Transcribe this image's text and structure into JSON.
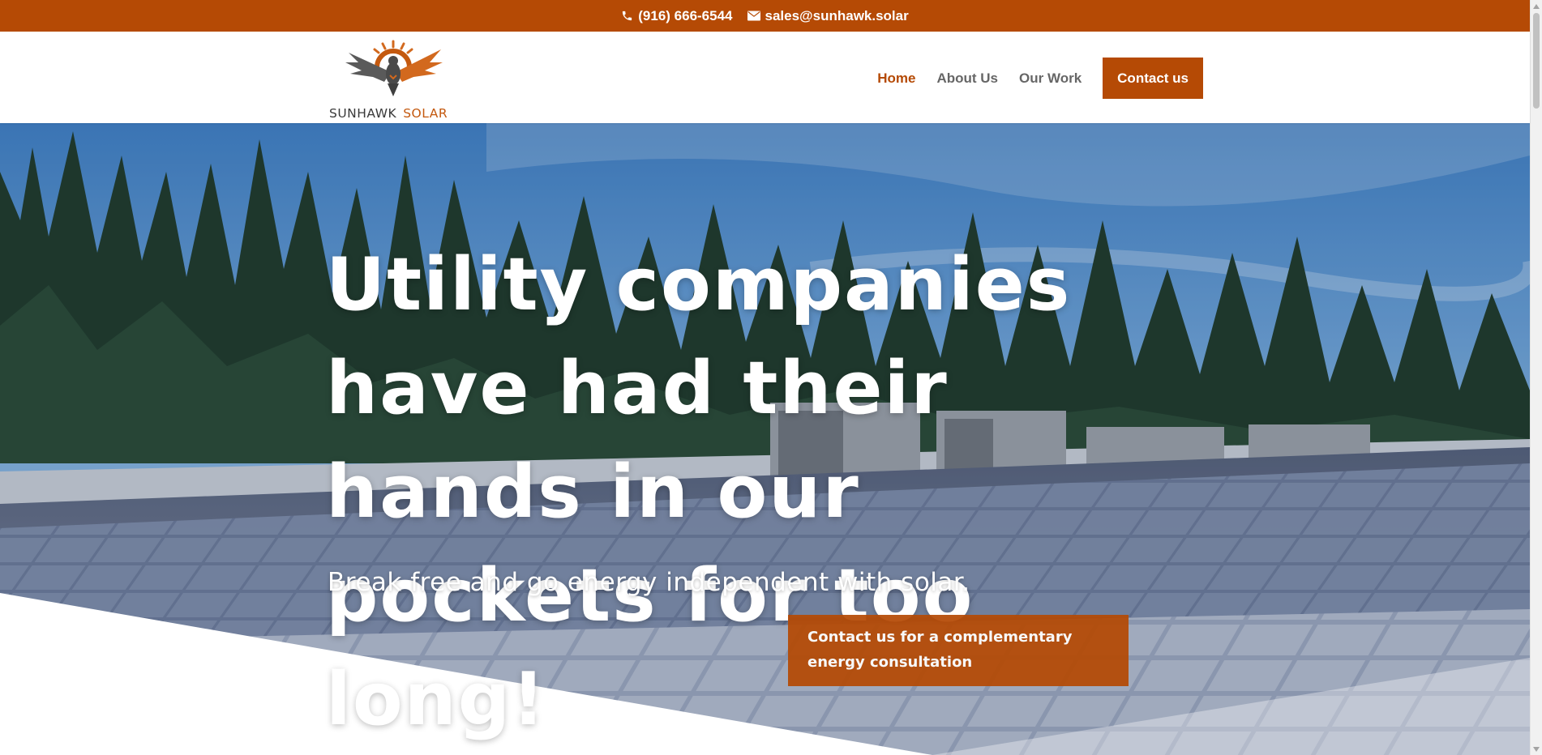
{
  "topbar": {
    "phone": "(916) 666-6544",
    "email": "sales@sunhawk.solar",
    "phone_icon": "phone-icon",
    "email_icon": "envelope-icon"
  },
  "logo": {
    "word1": "SUNHAWK",
    "word2": "SOLAR"
  },
  "nav": {
    "items": [
      {
        "label": "Home",
        "active": true
      },
      {
        "label": "About Us",
        "active": false
      },
      {
        "label": "Our Work",
        "active": false
      }
    ],
    "cta_label": "Contact us"
  },
  "hero": {
    "title": "Utility companies have had their hands in our pockets for too long!",
    "subtitle": "Break free and go energy independent with solar.",
    "button_label": "Contact us for a complementary energy consultation"
  },
  "colors": {
    "brand": "#b54a05",
    "nav_text": "#666666",
    "white": "#ffffff"
  }
}
